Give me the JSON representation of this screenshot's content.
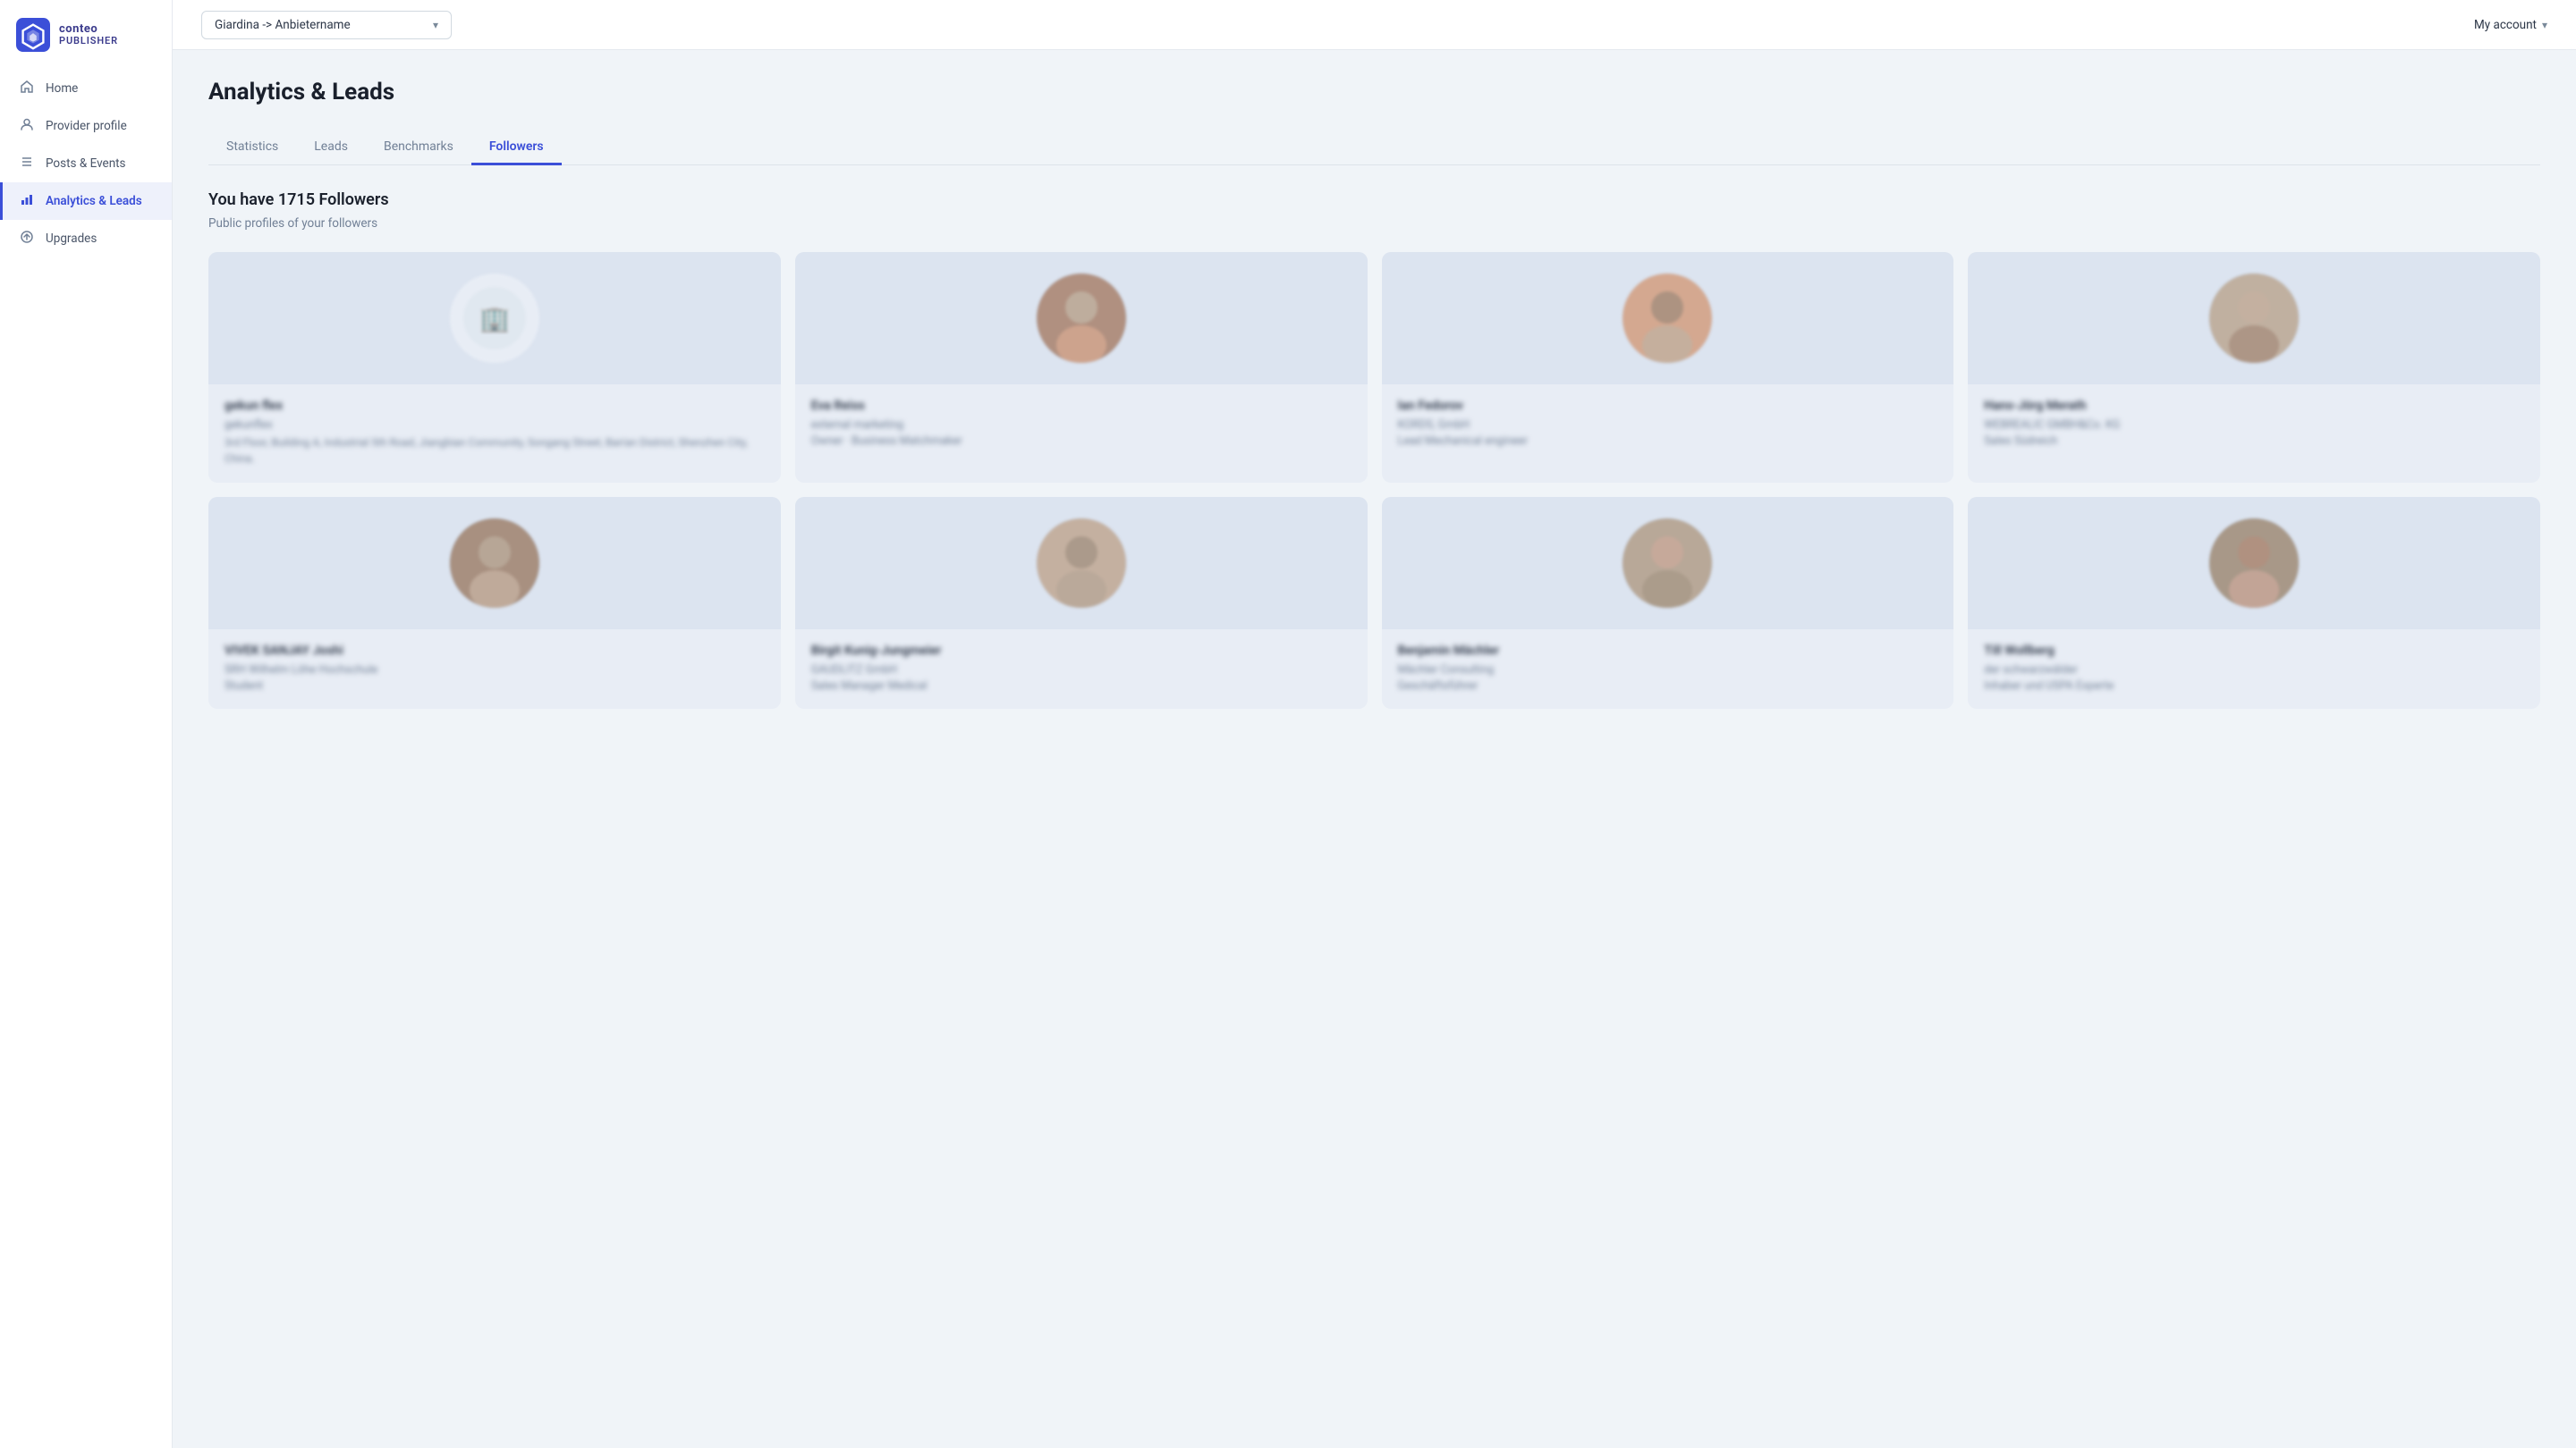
{
  "logo": {
    "conteo": "conteo",
    "publisher": "PUBLISHER"
  },
  "nav": {
    "items": [
      {
        "id": "home",
        "label": "Home",
        "icon": "🏠",
        "active": false
      },
      {
        "id": "provider-profile",
        "label": "Provider profile",
        "icon": "👤",
        "active": false
      },
      {
        "id": "posts-events",
        "label": "Posts & Events",
        "icon": "☰",
        "active": false
      },
      {
        "id": "analytics-leads",
        "label": "Analytics & Leads",
        "icon": "📊",
        "active": true
      },
      {
        "id": "upgrades",
        "label": "Upgrades",
        "icon": "⬆",
        "active": false
      }
    ]
  },
  "topbar": {
    "dropdown_value": "Giardina -> Anbietername",
    "my_account": "My account"
  },
  "page": {
    "title": "Analytics & Leads",
    "tabs": [
      {
        "id": "statistics",
        "label": "Statistics",
        "active": false
      },
      {
        "id": "leads",
        "label": "Leads",
        "active": false
      },
      {
        "id": "benchmarks",
        "label": "Benchmarks",
        "active": false
      },
      {
        "id": "followers",
        "label": "Followers",
        "active": true
      }
    ],
    "followers_heading": "You have 1715 Followers",
    "followers_sub": "Public profiles of your followers"
  },
  "followers": [
    {
      "id": 1,
      "name": "gekun flex",
      "company": "gekunflex",
      "detail": "3rd Floor, Building A, Industrial 5th Road, Jiangbian Community, Songang Street, Ban'an District, Shenzhen City, China.",
      "role": "",
      "avatar_type": "logo"
    },
    {
      "id": 2,
      "name": "Eva Reiss",
      "company": "external marketing",
      "detail": "",
      "role": "Owner · Business Matchmaker",
      "avatar_type": "photo"
    },
    {
      "id": 3,
      "name": "Ian Fedorov",
      "company": "KORDS, GmbH",
      "detail": "",
      "role": "Lead Mechanical engineer",
      "avatar_type": "photo"
    },
    {
      "id": 4,
      "name": "Hans-Jörg Merath",
      "company": "WEBREALIC GMBH&Co. KG",
      "detail": "",
      "role": "Sales Südreich",
      "avatar_type": "photo"
    },
    {
      "id": 5,
      "name": "VIVEK SANJAY Joshi",
      "company": "SRH Wilhelm Löhe Hochschule",
      "detail": "",
      "role": "Student",
      "avatar_type": "photo"
    },
    {
      "id": 6,
      "name": "Birgit Kunig-Jungmeier",
      "company": "GAUDLITZ GmbH",
      "detail": "",
      "role": "Sales Manager Medical",
      "avatar_type": "photo"
    },
    {
      "id": 7,
      "name": "Benjamin Mächler",
      "company": "Mächler Consulting",
      "detail": "",
      "role": "Geschäftsführer",
      "avatar_type": "photo"
    },
    {
      "id": 8,
      "name": "Till Wollberg",
      "company": "der schwarzwälder",
      "detail": "",
      "role": "Inhaber und USPA Experte",
      "avatar_type": "photo"
    }
  ]
}
